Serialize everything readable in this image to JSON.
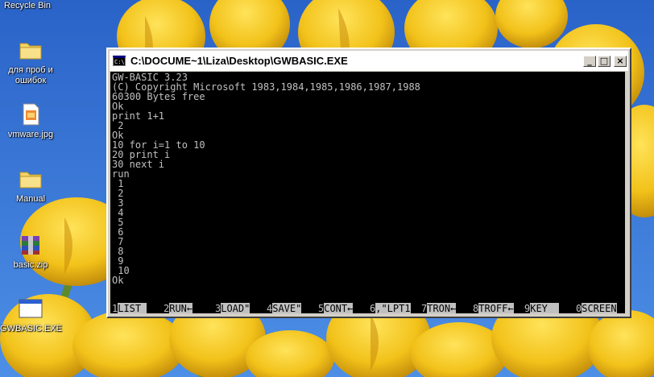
{
  "desktop": {
    "icons": [
      {
        "label": "Recycle Bin",
        "icon": "recycle-bin-icon"
      },
      {
        "label": "для проб и ошибок",
        "icon": "folder-icon"
      },
      {
        "label": "vmware.jpg",
        "icon": "image-file-icon"
      },
      {
        "label": "Manual",
        "icon": "folder-icon"
      },
      {
        "label": "basic.zip",
        "icon": "archive-icon"
      },
      {
        "label": "GWBASIC.EXE",
        "icon": "program-window-icon"
      }
    ]
  },
  "window": {
    "title": "C:\\DOCUME~1\\Liza\\Desktop\\GWBASIC.EXE",
    "icon_text": "C:\\",
    "buttons": {
      "minimize": "_",
      "maximize": "□",
      "close": "×"
    },
    "console_lines": [
      "GW-BASIC 3.23",
      "(C) Copyright Microsoft 1983,1984,1985,1986,1987,1988",
      "60300 Bytes free",
      "Ok",
      "print 1+1",
      " 2",
      "Ok",
      "10 for i=1 to 10",
      "20 print i",
      "30 next i",
      "run",
      " 1",
      " 2",
      " 3",
      " 4",
      " 5",
      " 6",
      " 7",
      " 8",
      " 9",
      " 10",
      "Ok"
    ],
    "function_keys": [
      {
        "num": "1",
        "label": "LIST "
      },
      {
        "num": "2",
        "label": "RUN←"
      },
      {
        "num": "3",
        "label": "LOAD\""
      },
      {
        "num": "4",
        "label": "SAVE\""
      },
      {
        "num": "5",
        "label": "CONT←"
      },
      {
        "num": "6",
        "label": ",\"LPT1"
      },
      {
        "num": "7",
        "label": "TRON←"
      },
      {
        "num": "8",
        "label": "TROFF←"
      },
      {
        "num": "9",
        "label": "KEY  "
      },
      {
        "num": "0",
        "label": "SCREEN"
      }
    ]
  },
  "colors": {
    "console_bg": "#000000",
    "console_fg": "#c0c0c0",
    "sky": "#2f6fd4",
    "tulip": "#f2c21a"
  }
}
